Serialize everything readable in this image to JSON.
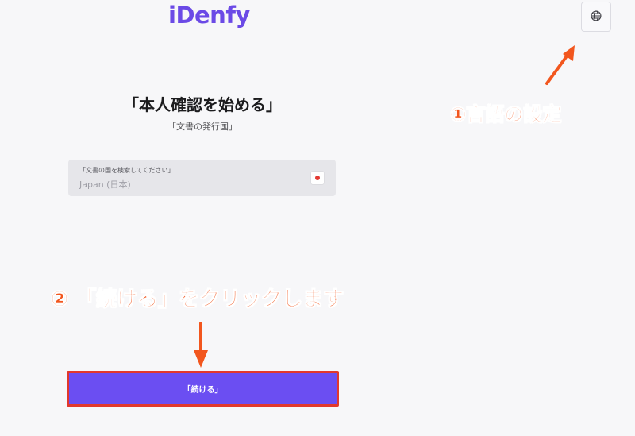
{
  "header": {
    "logo_text": "iDenfy",
    "language_button_icon": "globe-icon"
  },
  "main": {
    "title": "「本人確認を始める」",
    "subtitle": "「文書の発行国」",
    "country_field": {
      "label": "「文書の国を検索してください」...",
      "value": "Japan (日本)",
      "flag_icon": "japan-flag-icon"
    },
    "continue_label": "「続ける」"
  },
  "annotations": {
    "step1": "①言語の設定",
    "step2": "② 「続ける」をクリックします"
  },
  "colors": {
    "brand": "#6b4ae6",
    "button": "#6b4ef2",
    "annotation": "#f2561e",
    "highlight_border": "#e2382c"
  }
}
